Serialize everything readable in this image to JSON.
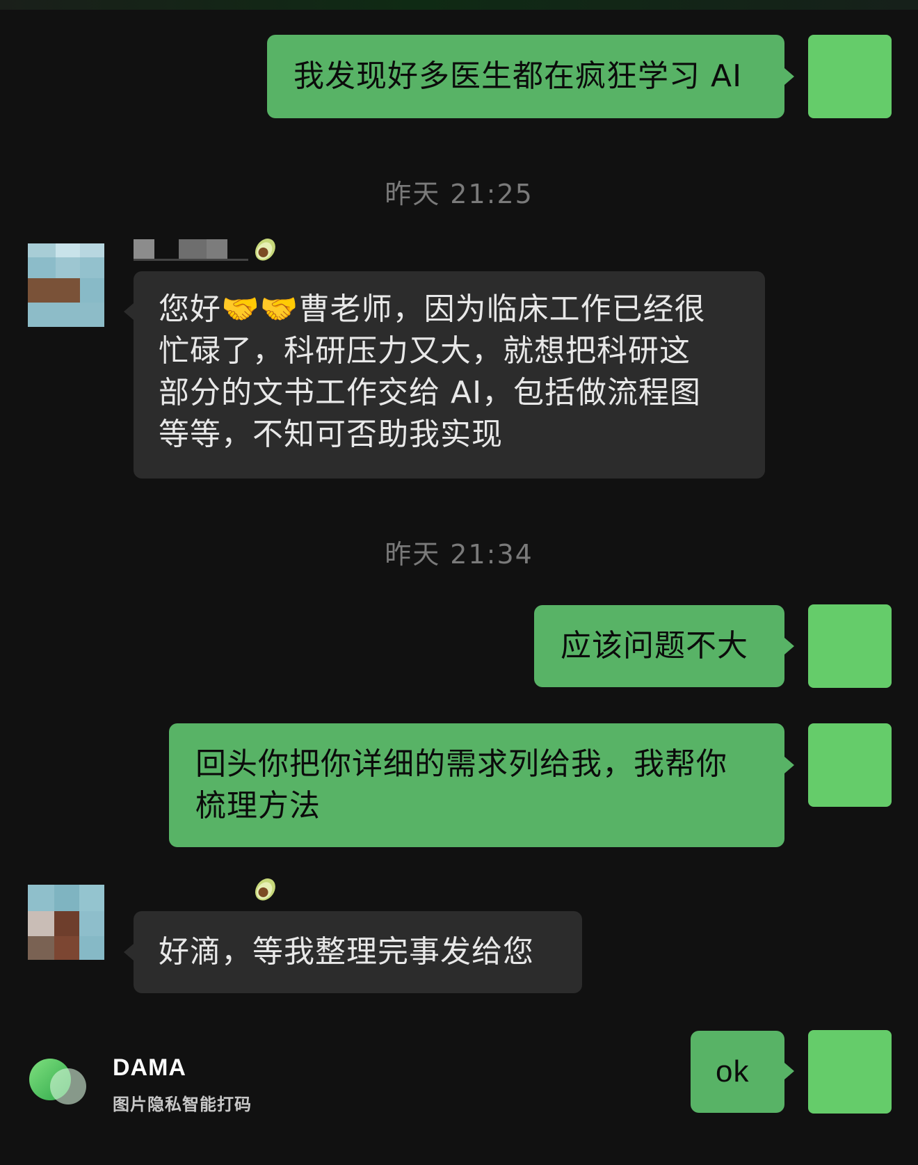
{
  "messages": [
    {
      "id": "m1",
      "direction": "out",
      "text": "我发现好多医生都在疯狂学习 AI"
    },
    {
      "id": "m2",
      "direction": "in",
      "text": "您好🤝🤝曹老师，因为临床工作已经很忙碌了，科研压力又大，就想把科研这部分的文书工作交给 AI，包括做流程图等等，不知可否助我实现"
    },
    {
      "id": "m3",
      "direction": "out",
      "text": "应该问题不大"
    },
    {
      "id": "m4",
      "direction": "out",
      "text": "回头你把你详细的需求列给我，我帮你梳理方法"
    },
    {
      "id": "m5",
      "direction": "in",
      "text": "好滴，等我整理完事发给您"
    },
    {
      "id": "m6",
      "direction": "out",
      "text": "ok"
    }
  ],
  "m2_lines": [
    "您好🤝🤝曹老师，因为临床工作已经很",
    "忙碌了，科研压力又大，就想把科研这",
    "部分的文书工作交给 AI，包括做流程图",
    "等等，不知可否助我实现"
  ],
  "m4_lines": [
    "回头你把你详细的需求列给我，我帮你",
    "梳理方法"
  ],
  "timestamps": [
    "昨天 21:25",
    "昨天 21:34"
  ],
  "icons": {
    "sender_badge": "avocado-icon",
    "watermark": "dama-logo-icon"
  },
  "watermark": {
    "title": "DAMA",
    "subtitle": "图片隐私智能打码"
  },
  "colors": {
    "background": "#111111",
    "outgoing_bubble": "#58b366",
    "incoming_bubble": "#2c2c2c",
    "self_avatar": "#65cc6a",
    "timestamp_text": "#7a7a7a"
  }
}
